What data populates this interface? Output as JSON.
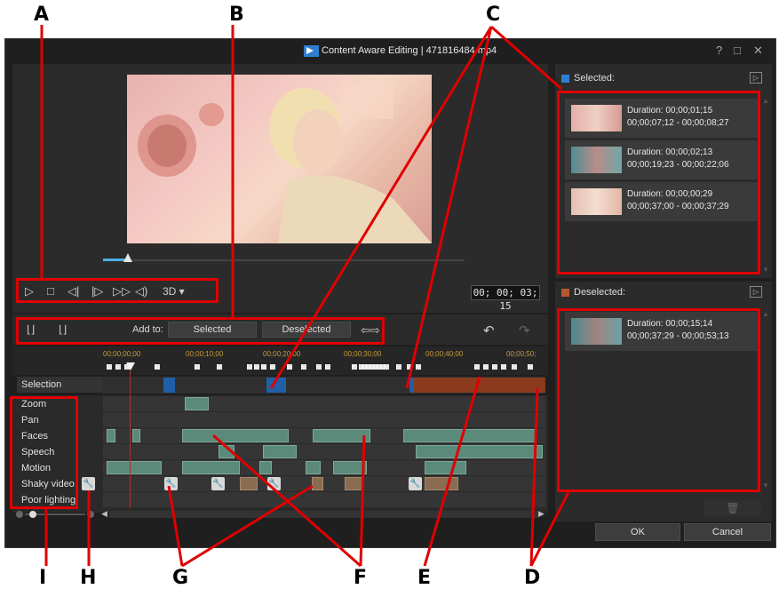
{
  "window": {
    "title": "Content Aware Editing  |  471816484.mp4",
    "help": "?",
    "maximize": "□",
    "close": "✕"
  },
  "player": {
    "timecode": "00; 00; 03; 15",
    "mode_3d": "3D",
    "position_fraction": 0.04
  },
  "toolbar": {
    "add_to_label": "Add to:",
    "selected_button": "Selected",
    "deselected_button": "Deselected"
  },
  "ruler": [
    "00;00;00;00",
    "00;00;10;00",
    "00;00;20;00",
    "00;00;30;00",
    "00;00;40;00",
    "00;00;50;"
  ],
  "track_labels": {
    "selection": "Selection",
    "zoom": "Zoom",
    "pan": "Pan",
    "faces": "Faces",
    "speech": "Speech",
    "motion": "Motion",
    "shaky": "Shaky video",
    "poor_lighting": "Poor lighting"
  },
  "side": {
    "selected_header": "Selected:",
    "deselected_header": "Deselected:",
    "selected_clips": [
      {
        "duration": "Duration: 00;00;01;15",
        "range": "00;00;07;12 - 00;00;08;27"
      },
      {
        "duration": "Duration: 00;00;02;13",
        "range": "00;00;19;23 - 00;00;22;06"
      },
      {
        "duration": "Duration: 00;00;00;29",
        "range": "00;00;37;00 - 00;00;37;29"
      }
    ],
    "deselected_clips": [
      {
        "duration": "Duration: 00;00;15;14",
        "range": "00;00;37;29 - 00;00;53;13"
      }
    ]
  },
  "buttons": {
    "ok": "OK",
    "cancel": "Cancel"
  },
  "callouts": {
    "A": "A",
    "B": "B",
    "C": "C",
    "D": "D",
    "E": "E",
    "F": "F",
    "G": "G",
    "H": "H",
    "I": "I"
  },
  "colors": {
    "highlight": "#e00000",
    "selected_marker": "#1f5fa8",
    "deselected_range": "#8b3a1e",
    "track_segment": "#5b8a7a",
    "shaky_segment": "#8a6c52"
  }
}
